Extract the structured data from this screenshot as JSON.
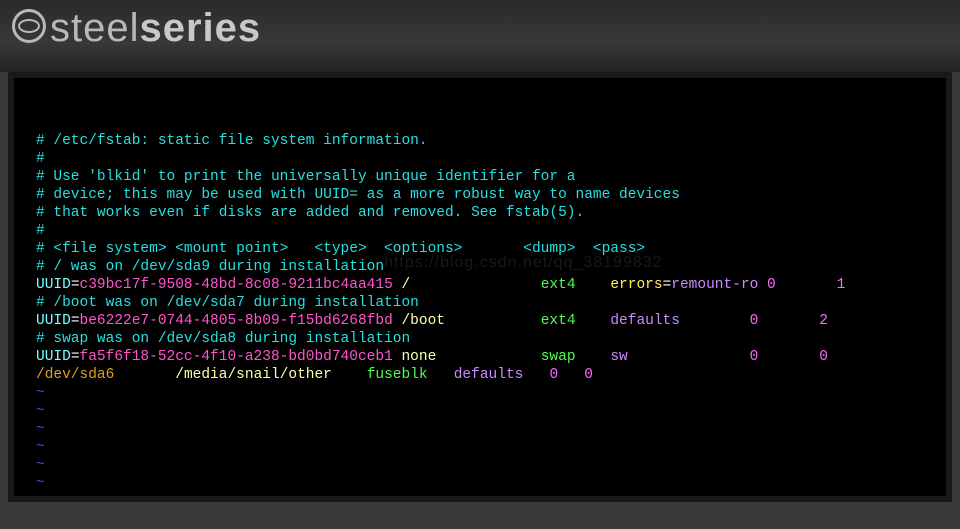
{
  "brand": {
    "thin": "steel",
    "bold": "series"
  },
  "watermark": "https://blog.csdn.net/qq_38199832",
  "fstab": {
    "comments": [
      "# /etc/fstab: static file system information.",
      "#",
      "# Use 'blkid' to print the universally unique identifier for a",
      "# device; this may be used with UUID= as a more robust way to name devices",
      "# that works even if disks are added and removed. See fstab(5).",
      "#",
      "# <file system> <mount point>   <type>  <options>       <dump>  <pass>",
      "# / was on /dev/sda9 during installation"
    ],
    "line1": {
      "key": "UUID",
      "uuid": "c39bc17f-9508-48bd-8c08-9211bc4aa415",
      "mount": "/",
      "type": "ext4",
      "optkey": "errors",
      "optval": "remount-ro",
      "dump": "0",
      "pass": "1"
    },
    "comment_boot": "# /boot was on /dev/sda7 during installation",
    "line2": {
      "key": "UUID",
      "uuid": "be6222e7-0744-4805-8b09-f15bd6268fbd",
      "mount": "/boot",
      "type": "ext4",
      "opt": "defaults",
      "dump": "0",
      "pass": "2"
    },
    "comment_swap": "# swap was on /dev/sda8 during installation",
    "line3": {
      "key": "UUID",
      "uuid": "fa5f6f18-52cc-4f10-a238-bd0bd740ceb1",
      "mount": "none",
      "type": "swap",
      "opt": "sw",
      "dump": "0",
      "pass": "0"
    },
    "line4": {
      "dev": "/dev/sda6",
      "mount": "/media/snail/other",
      "type": "fuseblk",
      "opt": "defaults",
      "dump": "0",
      "pass": "0"
    },
    "tilde": "~"
  }
}
